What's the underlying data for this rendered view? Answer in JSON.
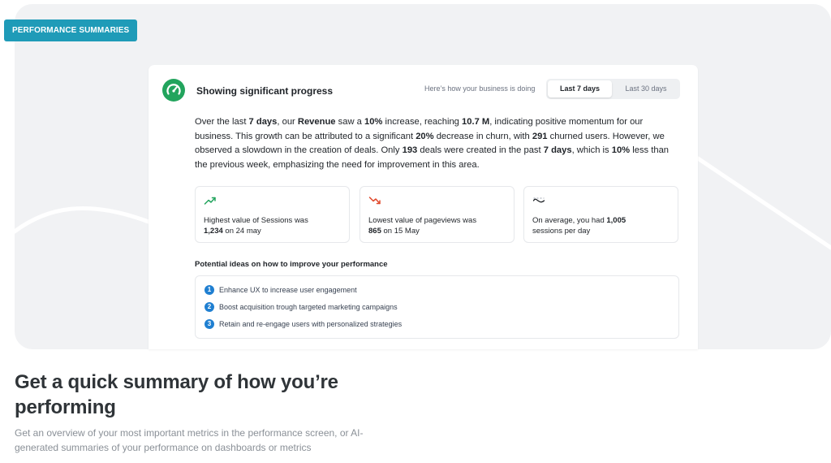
{
  "tag": {
    "label": "PERFORMANCE SUMMARIES"
  },
  "card": {
    "status_title": "Showing significant progress",
    "period_caption": "Here’s how your business is doing",
    "periods": {
      "active": "Last 7 days",
      "inactive": "Last 30 days"
    },
    "summary": {
      "t1": "Over the last ",
      "b1": "7 days",
      "t2": ", our ",
      "b2": "Revenue",
      "t3": " saw a ",
      "b3": "10%",
      "t4": " increase, reaching ",
      "b4": "10.7 M",
      "t5": ", indicating positive momentum for our business. This growth can be attributed to a significant ",
      "b5": "20%",
      "t6": " decrease in churn, with ",
      "b6": "291",
      "t7": " churned users. However, we observed a slowdown in the creation of deals. Only ",
      "b7": "193",
      "t8": " deals were created in the past ",
      "b8": "7 days",
      "t9": ", which is ",
      "b9": "10%",
      "t10": " less than the previous week, emphasizing the need for improvement in this area."
    },
    "stats": [
      {
        "icon": "trend-up-icon",
        "pre": "Highest value of Sessions was",
        "bold": "1,234",
        "post": " on 24 may"
      },
      {
        "icon": "trend-down-icon",
        "pre": "Lowest value of pageviews was",
        "bold": "865",
        "post": " on 15 May"
      },
      {
        "icon": "average-wave-icon",
        "pre": "On average, you had ",
        "bold": "1,005",
        "post": "sessions per day"
      }
    ],
    "ideas_title": "Potential ideas on how to improve your performance",
    "ideas": [
      {
        "num": "1",
        "text": "Enhance UX to increase user engagement"
      },
      {
        "num": "2",
        "text": "Boost acquisition trough targeted marketing campaigns"
      },
      {
        "num": "3",
        "text": "Retain and re-engage users with personalized strategies"
      }
    ]
  },
  "headline": "Get a quick summary of how you’re performing",
  "subtext": "Get an overview of your most important metrics in the performance screen, or AI-generated summaries of your performance on dashboards or metrics",
  "colors": {
    "tag_bg": "#1f9bb8",
    "status_green": "#22a45d",
    "trend_up": "#22a45d",
    "trend_down": "#e0482b",
    "idea_number": "#1f7fd1",
    "hero_bg": "#f1f2f4"
  }
}
